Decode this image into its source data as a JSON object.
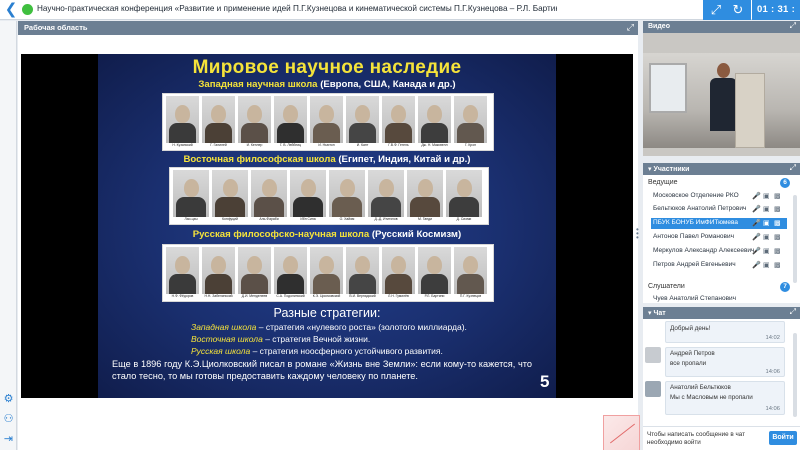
{
  "topbar": {
    "title": "Научно-практическая конференция «Развитие и применение идей П.Г.Кузнецова и кинематической системы П.Г.Кузнецова – Р.Л. Бартини»",
    "timer": "01 : 31 : 32",
    "icons": [
      "back-icon",
      "fullscreen-icon",
      "refresh-icon"
    ]
  },
  "workspace": {
    "title": "Рабочая область"
  },
  "slide": {
    "title": "Мировое научное наследие",
    "western": {
      "y": "Западная научная школа",
      "w": "(Европа, США, Канада и др.)"
    },
    "eastern": {
      "y": "Восточная философская школа",
      "w": "(Египет, Индия, Китай и др.)"
    },
    "russian": {
      "y": "Русская философско-научная школа",
      "w": "(Русский Космизм)"
    },
    "western_names": [
      "Н. Кузанский",
      "Г. Галилей",
      "И. Кеплер",
      "Г. В. Лейбниц",
      "И. Ньютон",
      "И. Кант",
      "Г.В.Ф. Гегель",
      "Дж. Н. Максвелл",
      "Г. Крон"
    ],
    "eastern_names": [
      "Лао-цзы",
      "Конфуций",
      "Аль-Фараби",
      "Ибн Сина",
      "О. Хайям",
      "Д.-Д. Итигэлов",
      "М. Ганди",
      "Д. Сиоми"
    ],
    "russian_names": [
      "Н.Ф. Фёдоров",
      "Н.Н. Забелинский",
      "Д.И. Менделеев",
      "С.А. Подолинский",
      "К.Э. Циолковский",
      "В.И. Вернадский",
      "Л.Н. Гумилёв",
      "Р.Л. Бартини",
      "П.Г. Кузнецов"
    ],
    "strategies_title": "Разные стратегии:",
    "strategies": [
      {
        "y": "Западная школа",
        "w": " – стратегия «нулевого роста» (золотого миллиарда)."
      },
      {
        "y": "Восточная школа",
        "w": " – стратегия Вечной жизни."
      },
      {
        "y": "Русская школа",
        "w": " – стратегия ноосферного устойчивого развития."
      }
    ],
    "quote": "Еще в 1896 году К.Э.Циолковский писал в романе «Жизнь вне Земли»: если кому-то кажется, что стало тесно, то мы готовы предоставить каждому человеку по планете.",
    "number": "5"
  },
  "video": {
    "title": "Видео"
  },
  "participants": {
    "title": "Участники",
    "hosts_label": "Ведущие",
    "hosts_count": "6",
    "hosts": [
      "Московское Отделение РКО",
      "Бельтюков Анатолий Петрович",
      "ПБУК БОНУБ ИмФИТюмева",
      "Антонов Павел Романович",
      "Меркулов Александр Алексеевич",
      "Петров Андрей Евгеньевич"
    ],
    "listeners_label": "Слушатели",
    "listeners_count": "7",
    "listeners": [
      "Чуев Анатолий Степанович"
    ]
  },
  "chat": {
    "title": "Чат",
    "messages": [
      {
        "author": "",
        "text": "Добрый день!",
        "time": "14:02"
      },
      {
        "author": "Андрей Петров",
        "text": "все пропали",
        "time": "14:06"
      },
      {
        "author": "Анатолий Бельтюков",
        "text": "Мы с Масловым не пропали",
        "time": "14:06"
      }
    ],
    "hint": "Чтобы написать сообщение в чат необходимо войти",
    "login_label": "Войти"
  },
  "colors": {
    "accent": "#2f8de0",
    "panel_header": "#6c7f93",
    "slide_yellow": "#f5e33a",
    "online": "#3fbf3f"
  }
}
